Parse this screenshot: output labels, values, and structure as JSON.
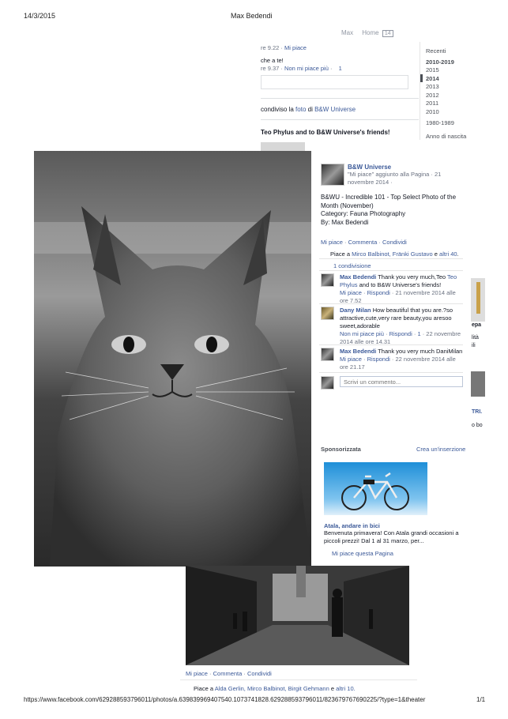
{
  "print": {
    "date": "14/3/2015",
    "title": "Max Bedendi",
    "url": "https://www.facebook.com/629288593796011/photos/a.639839969407540.1073741828.629288593796011/823679767690225/?type=1&theater",
    "page": "1/1"
  },
  "nav": {
    "profile": "Max",
    "home": "Home",
    "home_count": "14"
  },
  "background": {
    "line1_time": "re 9.22 ·",
    "line1_like": "Mi piace",
    "line2": "che a te!",
    "line3_time": "re 9.37 ·",
    "line3_unlike": "Non mi piace più",
    "line3_count": "1",
    "shared_prefix": "condiviso la",
    "shared_link1": "foto",
    "shared_mid": "di",
    "shared_link2": "B&W Universe",
    "teo_line": "Teo Phylus and to B&W Universe's friends!"
  },
  "timeline": {
    "items": [
      "Recenti",
      "2010-2019",
      "2015",
      "2014",
      "2013",
      "2012",
      "2011",
      "2010",
      "1980-1989",
      "Anno di nascita"
    ]
  },
  "post": {
    "page_name": "B&W Universe",
    "added": "\"Mi piace\" aggiunto alla Pagina · 21 novembre 2014 ·",
    "text1": "B&WU - Incredible 101 - Top Select Photo of the Month (November)",
    "text2": "Category: Fauna Photography",
    "text3": "By: Max Bedendi",
    "like": "Mi piace",
    "comment": "Commenta",
    "share": "Condividi",
    "likes_prefix": "Piace a",
    "likes_names": "Mirco Balbinot, Fränki Gustavo",
    "likes_and": "e",
    "likes_others": "altri 40",
    "shares": "1 condivisione"
  },
  "comments": [
    {
      "author": "Max Bedendi",
      "text_a": "Thank you very much,Teo",
      "mention": "Teo Phylus",
      "text_b": "and to B&W Universe's friends!",
      "like": "Mi piace",
      "reply": "Rispondi",
      "time": "21 novembre 2014 alle ore 7.52"
    },
    {
      "author": "Dany Milan",
      "text": "How beautiful that you are.?so attractive,cute,very rare beauty,you aresoo sweet,adorable",
      "unlike": "Non mi piace più",
      "reply": "Rispondi",
      "count": "1",
      "time": "22 novembre 2014 alle ore 14.31"
    },
    {
      "author": "Max Bedendi",
      "text": "Thank you very much DaniMilan",
      "like": "Mi piace",
      "reply": "Rispondi",
      "time": "22 novembre 2014 alle ore 21.17"
    }
  ],
  "comment_input": {
    "placeholder": "Scrivi un commento..."
  },
  "sponsored": {
    "heading": "Sponsorizzata",
    "create": "Crea un'inserzione",
    "ad_title": "Atala, andare in bici",
    "ad_text": "Benvenuta primavera! Con Atala grandi occasioni a piccoli prezzi! Dal 1 al 31 marzo, per...",
    "ad_like": "Mi piace questa Pagina"
  },
  "right_snippets": {
    "a": "epa",
    "b": "lità",
    "c": "ili",
    "d": "TRI.",
    "e": "o bo"
  },
  "lower": {
    "like": "Mi piace",
    "comment": "Commenta",
    "share": "Condividi",
    "likes_prefix": "Piace a",
    "likes_names": "Alda Gerlin, Mirco Balbinot, Birgit Gehmann",
    "likes_and": "e",
    "likes_others": "altri 10."
  }
}
